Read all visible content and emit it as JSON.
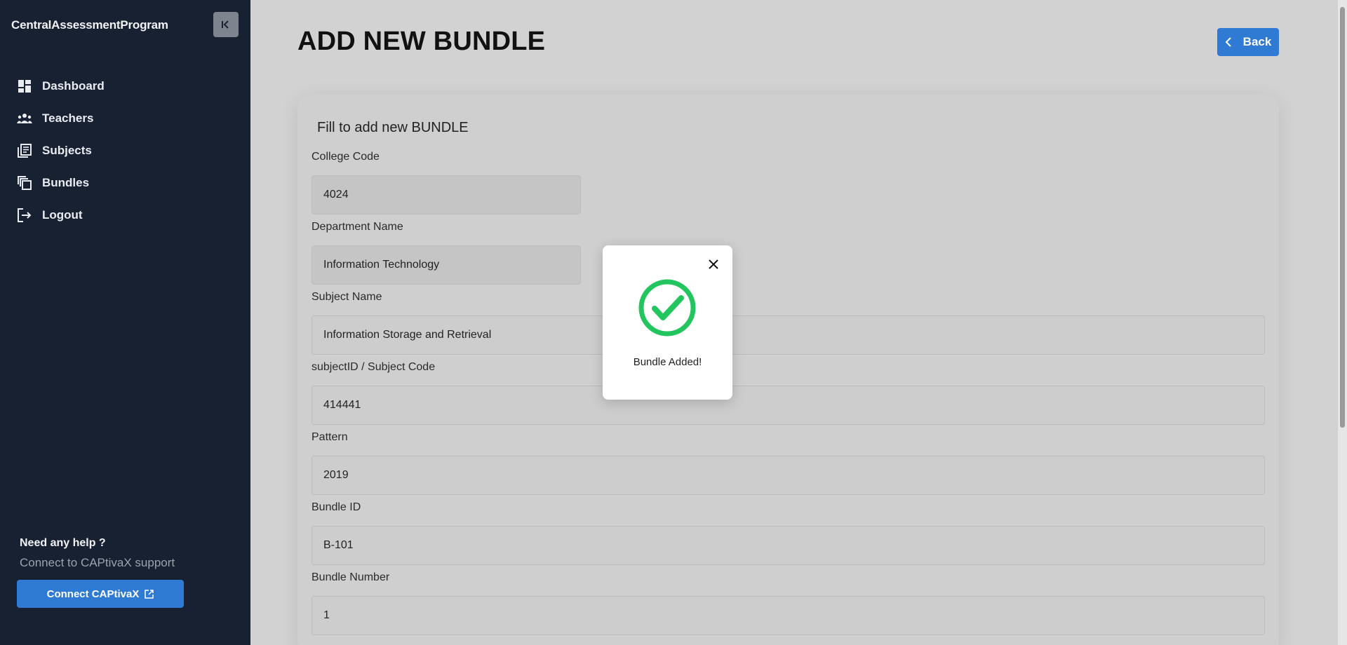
{
  "sidebar": {
    "brand": "CentralAssessmentProgram",
    "collapse_icon": "collapse-left-icon",
    "items": [
      {
        "label": "Dashboard",
        "icon": "dashboard-icon"
      },
      {
        "label": "Teachers",
        "icon": "people-icon"
      },
      {
        "label": "Subjects",
        "icon": "library-books-icon"
      },
      {
        "label": "Bundles",
        "icon": "copy-stack-icon"
      },
      {
        "label": "Logout",
        "icon": "logout-icon"
      }
    ],
    "help_title": "Need any help ?",
    "help_subtitle": "Connect to CAPtivaX support",
    "connect_label": "Connect CAPtivaX",
    "connect_icon": "external-link-icon"
  },
  "header": {
    "title": "ADD NEW BUNDLE",
    "back_label": "Back",
    "back_icon": "chevron-left-icon"
  },
  "form": {
    "heading": "Fill to add new BUNDLE",
    "fields": [
      {
        "label": "College Code",
        "value": "4024"
      },
      {
        "label": "Department Name",
        "value": "Information Technology"
      },
      {
        "label": "Subject Name",
        "value": "Information Storage and Retrieval"
      },
      {
        "label": "subjectID / Subject Code",
        "value": "414441"
      },
      {
        "label": "Pattern",
        "value": "2019"
      },
      {
        "label": "Bundle ID",
        "value": "B-101"
      },
      {
        "label": "Bundle Number",
        "value": "1"
      }
    ]
  },
  "modal": {
    "message": "Bundle Added!",
    "icon": "check-circle-icon",
    "close_icon": "close-icon"
  },
  "colors": {
    "sidebar_bg": "#182132",
    "accent": "#2f7ad3",
    "success": "#22c55e"
  }
}
